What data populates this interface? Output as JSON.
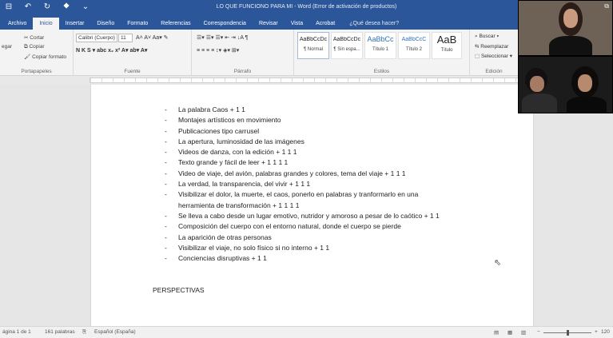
{
  "titlebar": {
    "title": "LO QUE FUNCIONO PARA MI - Word (Error de activación de productos)",
    "qat": [
      "⊟",
      "↶",
      "↻",
      "⯁",
      "⌄"
    ]
  },
  "tabs": [
    "Archivo",
    "Inicio",
    "Insertar",
    "Diseño",
    "Formato",
    "Referencias",
    "Correspondencia",
    "Revisar",
    "Vista",
    "Acrobat"
  ],
  "tell_me": "¿Qué desea hacer?",
  "ribbon": {
    "clipboard": {
      "label": "Portapapeles",
      "paste": "egar",
      "cut": "Cortar",
      "copy": "Copiar",
      "format_painter": "Copiar formato"
    },
    "font": {
      "label": "Fuente",
      "font_name": "Calibri (Cuerpo)",
      "font_size": "11",
      "row1": "A˄ A˅  Aa▾  ✎",
      "row2": "N  K  S ▾  abc  x₂  x²  A▾  ab▾  A▾"
    },
    "paragraph": {
      "label": "Párrafo",
      "row1": "☰▾ ☰▾ ☰▾  ⇤ ⇥  ↓A  ¶",
      "row2": "≡ ≡ ≡ ≡  ↕▾  ◈▾  ⊞▾"
    },
    "styles": {
      "label": "Estilos",
      "items": [
        {
          "sample": "AaBbCcDc",
          "name": "¶ Normal"
        },
        {
          "sample": "AaBbCcDc",
          "name": "¶ Sin espa..."
        },
        {
          "sample": "AaBbCc",
          "name": "Título 1"
        },
        {
          "sample": "AaBbCcC",
          "name": "Título 2"
        },
        {
          "sample": "AaB",
          "name": "Título"
        }
      ]
    },
    "editing": {
      "label": "Edición",
      "find": "⌕ Buscar ▾",
      "replace": "⇆ Reemplazar",
      "select": "⬚ Seleccionar ▾"
    }
  },
  "document": {
    "items": [
      "La palabra Caos + 1 1",
      "Montajes artísticos en movimiento",
      "Publicaciones tipo carrusel",
      "La apertura, luminosidad de las imágenes",
      "Videos de danza, con la edición + 1 1 1",
      "Texto grande y fácil de leer + 1 1 1 1",
      "Video de viaje, del avión, palabras grandes y colores, tema del viaje + 1 1 1",
      "La verdad, la transparencia, del vivir + 1 1 1",
      "Visibilizar el dolor, la muerte, el caos, ponerlo en palabras y tranformarlo en una herramienta de transformación + 1 1 1 1",
      "Se lleva a cabo desde un lugar emotivo, nutridor y amoroso a pesar de lo caótico + 1 1",
      "Composición del cuerpo con el entorno natural, donde el cuerpo se pierde",
      "La aparición de otras personas",
      "Visibilizar el viaje, no solo físico si no interno + 1 1",
      "Conciencias disruptivas + 1 1"
    ],
    "heading": "PERSPECTIVAS"
  },
  "statusbar": {
    "page": "ágina 1 de 1",
    "words": "161 palabras",
    "language": "Español (España)",
    "zoom": "120",
    "zoom_fraction": 0.5
  },
  "colors": {
    "accent": "#2b579a"
  }
}
